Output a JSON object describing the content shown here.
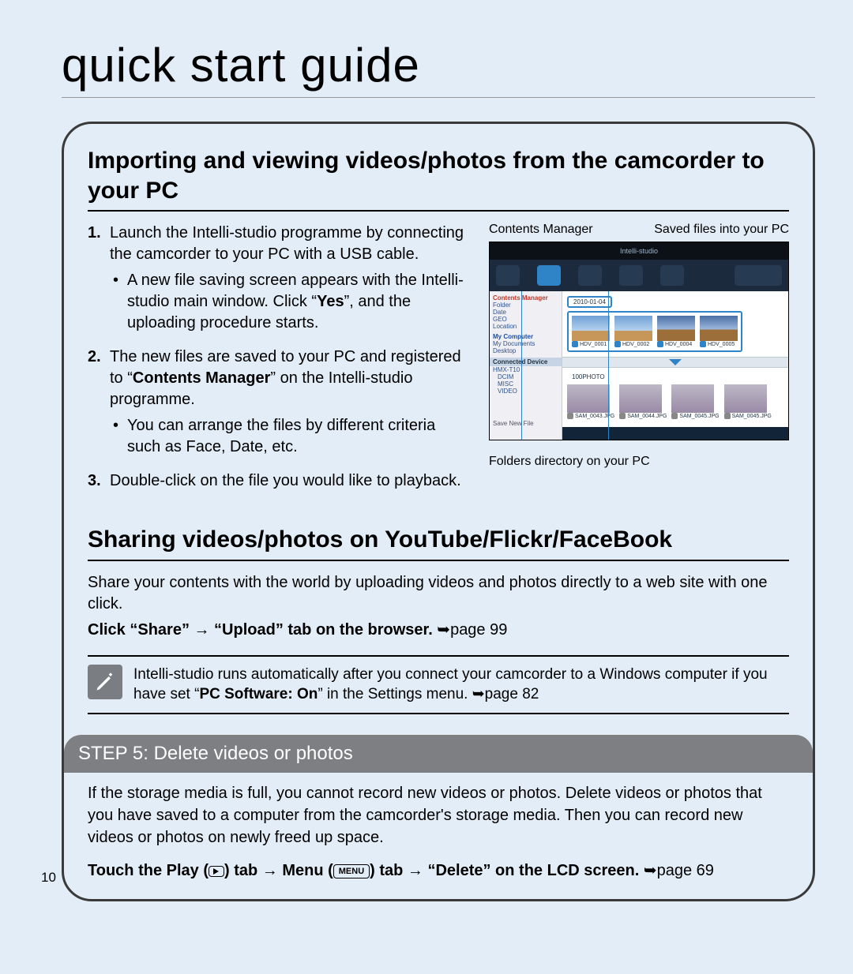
{
  "pageNumber": "10",
  "title": "quick start guide",
  "section1": {
    "heading": "Importing and viewing videos/photos from the camcorder to your PC",
    "steps": [
      {
        "n": "1.",
        "text": "Launch the Intelli-studio programme by connecting the camcorder to your PC with a USB cable.",
        "bullets": [
          "A new file saving screen appears with the Intelli-studio main window. Click “Yes”, and the uploading procedure starts."
        ],
        "bold": "Yes"
      },
      {
        "n": "2.",
        "text_before": "The new files are saved to your PC and registered to “",
        "bold": "Contents Manager",
        "text_after": "” on the Intelli-studio programme.",
        "bullets": [
          "You can arrange the files by different criteria such as Face, Date, etc."
        ]
      },
      {
        "n": "3.",
        "text": "Double-click on the file you would like to playback.",
        "bullets": []
      }
    ],
    "figure": {
      "label_left": "Contents Manager",
      "label_right": "Saved files into your PC",
      "label_bottom": "Folders directory on your PC",
      "ui": {
        "titlebar": "Intelli-studio",
        "side_sections": [
          "Contents Manager",
          "Folder",
          "Date",
          "GEO",
          "Location",
          "My Computer",
          "My Documents",
          "Desktop",
          "Connected Device",
          "HMX-T10",
          "DCIM",
          "MISC",
          "VIDEO",
          "Save New File"
        ],
        "date": "2010-01-04",
        "clip_names": [
          "HDV_0001",
          "HDV_0002",
          "HDV_0004",
          "HDV_0005"
        ],
        "folder_name": "100PHOTO",
        "photo_names": [
          "SAM_0043.JPG",
          "SAM_0044.JPG",
          "SAM_0045.JPG",
          "SAM_0045.JPG"
        ]
      }
    }
  },
  "section2": {
    "heading": "Sharing videos/photos on YouTube/Flickr/FaceBook",
    "para": "Share your contents with the world by uploading videos and photos directly to a web site with one click.",
    "instruction_bold": "Click “Share” → “Upload” tab on the browser.",
    "instruction_ref": " ➥page 99"
  },
  "note": {
    "text_before": "Intelli-studio runs automatically after you connect your camcorder to a Windows computer if you have set “",
    "bold": "PC Software: On",
    "text_after": "” in the Settings menu. ➥page 82"
  },
  "step5": {
    "bar": "STEP 5: Delete videos or photos",
    "para": "If the storage media is full, you cannot record new videos or photos. Delete videos or photos that you have saved to a computer from the camcorder's storage media. Then you can record new videos or photos on newly freed up space.",
    "tail_a": "Touch the Play (",
    "tail_b": ") tab → Menu (",
    "menu_label": "MENU",
    "tail_c": ") tab → “Delete” on the LCD screen.",
    "tail_ref": " ➥page 69"
  }
}
